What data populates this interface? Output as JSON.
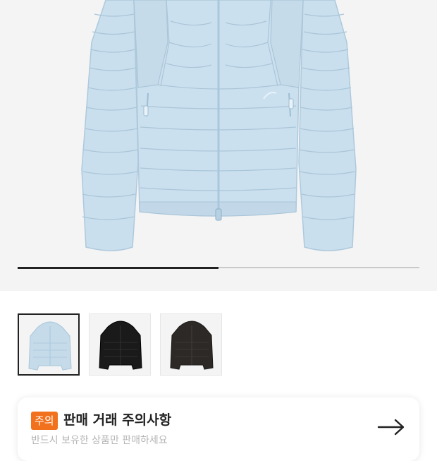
{
  "product_gallery": {
    "image_alt": "light blue hooded down jacket",
    "progress_fraction": 0.5,
    "colors": {
      "jacket": "#c5dbea",
      "jacket_shadow": "#a9c6da",
      "background": "#f4f4f4"
    }
  },
  "thumbnails": [
    {
      "color_name": "light blue",
      "color": "#c5dbea",
      "selected": true
    },
    {
      "color_name": "black",
      "color": "#1a1a1a",
      "selected": false
    },
    {
      "color_name": "dark brown",
      "color": "#2d2926",
      "selected": false
    }
  ],
  "notice": {
    "badge": "주의",
    "title": "판매 거래 주의사항",
    "subtitle": "반드시 보유한 상품만 판매하세요",
    "accent_color": "#f2711c"
  }
}
